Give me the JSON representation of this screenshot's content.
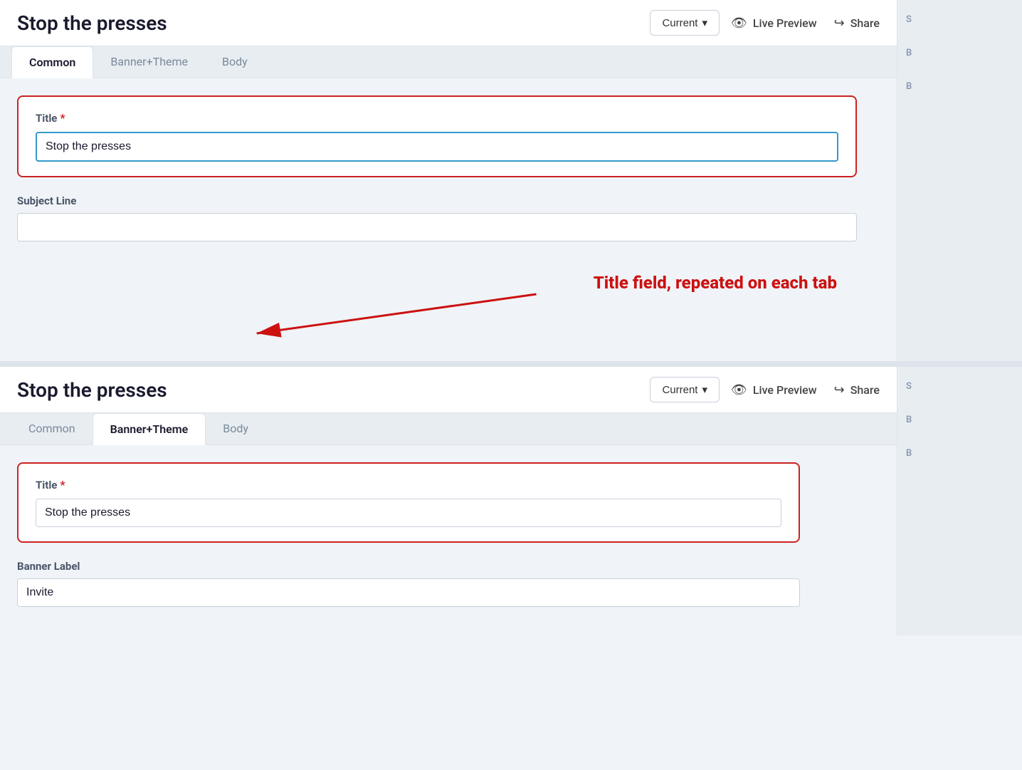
{
  "app": {
    "title": "Stop the presses"
  },
  "header": {
    "title": "Stop the presses",
    "current_button": "Current",
    "chevron": "▾",
    "live_preview": "Live Preview",
    "share": "Share"
  },
  "tabs_1": {
    "items": [
      {
        "id": "common",
        "label": "Common",
        "active": true
      },
      {
        "id": "banner_theme",
        "label": "Banner+Theme",
        "active": false
      },
      {
        "id": "body",
        "label": "Body",
        "active": false
      }
    ]
  },
  "section_1": {
    "title_label": "Title",
    "title_value": "Stop the presses",
    "title_placeholder": "",
    "subject_label": "Subject Line",
    "subject_value": "",
    "subject_placeholder": ""
  },
  "annotation": {
    "text": "Title field, repeated on each tab"
  },
  "header_2": {
    "title": "Stop the presses",
    "current_button": "Current",
    "chevron": "▾",
    "live_preview": "Live Preview",
    "share": "Share"
  },
  "tabs_2": {
    "items": [
      {
        "id": "common2",
        "label": "Common",
        "active": false
      },
      {
        "id": "banner_theme2",
        "label": "Banner+Theme",
        "active": true
      },
      {
        "id": "body2",
        "label": "Body",
        "active": false
      }
    ]
  },
  "section_2": {
    "title_label": "Title",
    "title_value": "Stop the presses",
    "title_placeholder": "",
    "banner_label": "Banner Label",
    "banner_value": "Invite"
  },
  "right_sidebar_1": {
    "labels": [
      "S",
      "B",
      "B"
    ]
  },
  "right_sidebar_2": {
    "labels": [
      "S",
      "B",
      "B"
    ]
  }
}
